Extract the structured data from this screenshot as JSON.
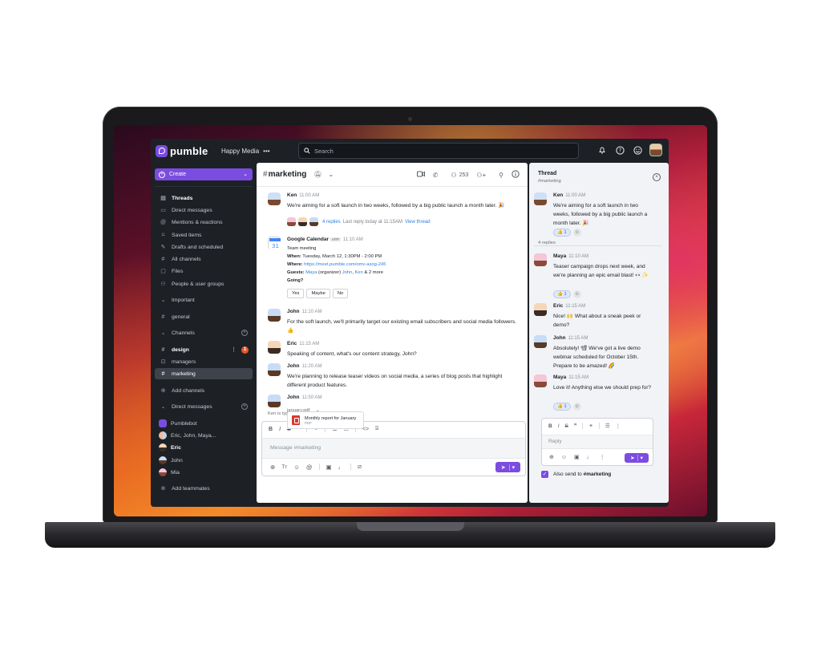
{
  "app": {
    "brand": "pumble",
    "workspace": "Happy Media",
    "workspace_more": "•••",
    "search_placeholder": "Search"
  },
  "sidebar": {
    "create_label": "Create",
    "nav": [
      {
        "label": "Threads",
        "icon": "threads-icon"
      },
      {
        "label": "Direct messages",
        "icon": "direct-messages-icon"
      },
      {
        "label": "Mentions & reactions",
        "icon": "at-icon"
      },
      {
        "label": "Saved items",
        "icon": "bookmark-icon"
      },
      {
        "label": "Drafts and scheduled",
        "icon": "pencil-icon"
      },
      {
        "label": "All channels",
        "icon": "channels-icon"
      },
      {
        "label": "Files",
        "icon": "file-icon"
      },
      {
        "label": "People & user groups",
        "icon": "people-icon"
      }
    ],
    "important_label": "Important",
    "important_channels": [
      "general"
    ],
    "channels_label": "Channels",
    "channels": [
      {
        "name": "design",
        "badge": "1"
      },
      {
        "name": "managers"
      },
      {
        "name": "marketing"
      }
    ],
    "add_channels": "Add channels",
    "dms_label": "Direct messages",
    "dms": [
      "Pumblebot",
      "Eric, John, Maya...",
      "Eric",
      "John",
      "Mia"
    ],
    "add_teammates": "Add teammates"
  },
  "channel": {
    "name": "marketing",
    "members": "253"
  },
  "messages": {
    "ken": {
      "name": "Ken",
      "time": "11:00 AM",
      "text": "We're aiming for a soft launch in two weeks, followed by a big public launch a month later. 🎉"
    },
    "replies": {
      "count": "4 replies",
      "last": "Last reply today at 11:15AM",
      "view": "View thread"
    },
    "calendar": {
      "name": "Google Calendar",
      "app_tag": "APP",
      "time": "11:10 AM",
      "event": "Team meeting",
      "when_label": "When:",
      "when": "Tuesday, March 12, 1:30PM - 2:00 PM",
      "where_label": "Where:",
      "where": "https://meet.pumble.com/omv-asog-245",
      "guests_label": "Guests:",
      "guest1": "Maya",
      "guest1_role": "(organizer)",
      "guest2": "John",
      "guest3": "Ken",
      "guests_more": "& 2 more",
      "going": "Going?",
      "yes": "Yes",
      "maybe": "Maybe",
      "no": "No"
    },
    "john1": {
      "name": "John",
      "time": "11:10 AM",
      "text": "For the soft launch, we'll primarily target our existing email subscribers and social media followers. 👍"
    },
    "eric": {
      "name": "Eric",
      "time": "11:15 AM",
      "text": "Speaking of content, what's our content strategy, John?"
    },
    "john2": {
      "name": "John",
      "time": "11:20 AM",
      "text": "We're planning to release teaser videos on social media, a series of blog posts that highlight different product features."
    },
    "john3": {
      "name": "John",
      "time": "11:50 AM",
      "file_label": "january.pdf",
      "file_name": "Monthly report for January",
      "file_type": "PDF"
    }
  },
  "typing": "Ken is typing",
  "composer": {
    "placeholder": "Message #marketing"
  },
  "thread": {
    "title": "Thread",
    "channel": "#marketing",
    "root": {
      "name": "Ken",
      "time": "11:00 AM",
      "text": "We're aiming for a soft launch in two weeks, followed by a big public launch a month later. 🎉",
      "reaction": "👍 1"
    },
    "count": "4 replies",
    "replies": [
      {
        "name": "Maya",
        "time": "11:10 AM",
        "text": "Teaser campaign drops next week, and we're planning an epic email blast! 👀✨",
        "reaction": "👍 1"
      },
      {
        "name": "Eric",
        "time": "11:15 AM",
        "text": "Nice! 🙌 What about a sneak peek or demo?"
      },
      {
        "name": "John",
        "time": "11:15 AM",
        "text": "Absolutely! 📽 We've got a live demo webinar scheduled for October 15th. Prepare to be amazed! 🌈"
      },
      {
        "name": "Maya",
        "time": "11:15 AM",
        "text": "Love it! Anything else we should prep for?",
        "reaction": "👍 1"
      }
    ],
    "reply_placeholder": "Reply",
    "also_send_prefix": "Also send to ",
    "also_send_channel": "#marketing"
  },
  "colors": {
    "accent": "#7b4ce0",
    "link": "#2f7fe0",
    "badge": "#e05a2a"
  }
}
